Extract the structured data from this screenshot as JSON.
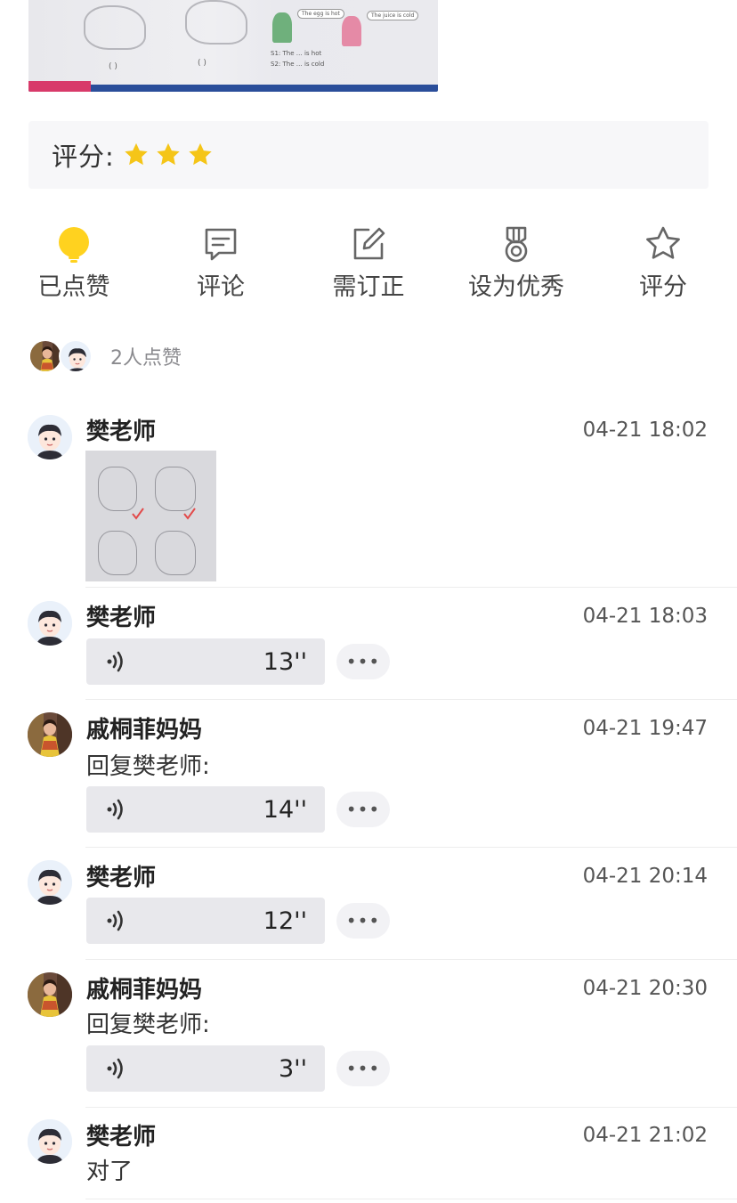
{
  "photo": {
    "bubble_1": "The egg is hot",
    "bubble_2": "The juice is cold",
    "line_1": "S1: The … is hot",
    "line_2": "S2: The … is cold",
    "brackets_1": "(    )",
    "brackets_2": "(    )"
  },
  "rating": {
    "label": "评分:",
    "stars": 3,
    "star_color": "#f5c518"
  },
  "actions": [
    {
      "label": "已点赞",
      "icon": "lightbulb-icon",
      "active": true
    },
    {
      "label": "评论",
      "icon": "comment-icon"
    },
    {
      "label": "需订正",
      "icon": "edit-icon"
    },
    {
      "label": "设为优秀",
      "icon": "medal-icon"
    },
    {
      "label": "评分",
      "icon": "star-icon"
    }
  ],
  "likes": {
    "text": "2人点赞"
  },
  "comments": [
    {
      "name": "樊老师",
      "time": "04-21 18:02",
      "type": "image"
    },
    {
      "name": "樊老师",
      "time": "04-21 18:03",
      "type": "voice",
      "duration": "13''",
      "more": "•••"
    },
    {
      "name": "戚桐菲妈妈",
      "time": "04-21 19:47",
      "type": "voice",
      "reply": "回复樊老师:",
      "duration": "14''",
      "more": "•••"
    },
    {
      "name": "樊老师",
      "time": "04-21 20:14",
      "type": "voice",
      "duration": "12''",
      "more": "•••"
    },
    {
      "name": "戚桐菲妈妈",
      "time": "04-21 20:30",
      "type": "voice",
      "reply": "回复樊老师:",
      "duration": "3''",
      "more": "•••"
    },
    {
      "name": "樊老师",
      "time": "04-21 21:02",
      "type": "text",
      "text": "对了"
    }
  ]
}
